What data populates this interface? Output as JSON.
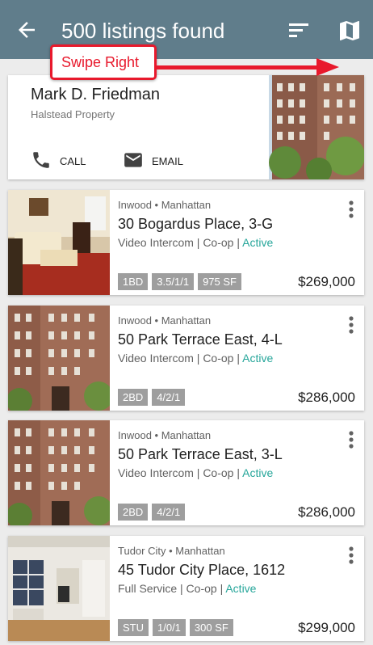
{
  "header": {
    "title": "500 listings found"
  },
  "callout": {
    "text": "Swipe Right"
  },
  "agent": {
    "name": "Mark D. Friedman",
    "company": "Halstead Property",
    "call_label": "CALL",
    "email_label": "EMAIL"
  },
  "listings": [
    {
      "location": "Inwood • Manhattan",
      "address": "30 Bogardus Place, 3-G",
      "features": "Video Intercom | Co-op |",
      "status": "Active",
      "badges": [
        "1BD",
        "3.5/1/1",
        "975 SF"
      ],
      "price": "$269,000"
    },
    {
      "location": "Inwood • Manhattan",
      "address": "50 Park Terrace East, 4-L",
      "features": "Video Intercom | Co-op |",
      "status": "Active",
      "badges": [
        "2BD",
        "4/2/1"
      ],
      "price": "$286,000"
    },
    {
      "location": "Inwood • Manhattan",
      "address": "50 Park Terrace East, 3-L",
      "features": "Video Intercom | Co-op |",
      "status": "Active",
      "badges": [
        "2BD",
        "4/2/1"
      ],
      "price": "$286,000"
    },
    {
      "location": "Tudor City • Manhattan",
      "address": "45 Tudor City Place, 1612",
      "features": "Full Service | Co-op |",
      "status": "Active",
      "badges": [
        "STU",
        "1/0/1",
        "300 SF"
      ],
      "price": "$299,000"
    }
  ],
  "colors": {
    "appbar": "#607d8b",
    "accent_status": "#26a69a",
    "callout": "#e8192c",
    "badge": "#9e9e9e"
  },
  "icons": {
    "back": "arrow-back-icon",
    "sort": "sort-icon",
    "map": "map-icon",
    "call": "phone-icon",
    "email": "email-icon",
    "more": "more-vert-icon"
  }
}
